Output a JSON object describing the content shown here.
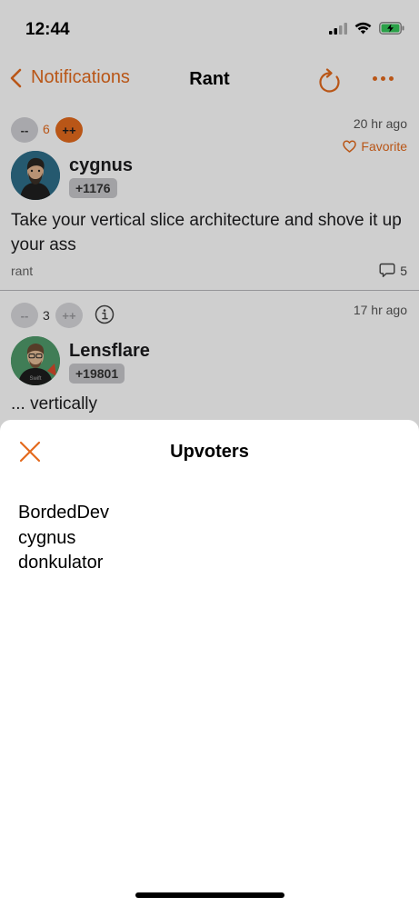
{
  "status_bar": {
    "time": "12:44"
  },
  "nav": {
    "back_label": "Notifications",
    "title": "Rant"
  },
  "rant": {
    "downvote_label": "--",
    "vote_count": "6",
    "upvote_label": "++",
    "time_ago": "20 hr ago",
    "favorite_label": "Favorite",
    "username": "cygnus",
    "score": "+1176",
    "text": "Take your vertical slice architecture and shove it up your ass",
    "tag": "rant",
    "comment_count": "5"
  },
  "comment": {
    "downvote_label": "--",
    "vote_count": "3",
    "upvote_label": "++",
    "time_ago": "17 hr ago",
    "username": "Lensflare",
    "score": "+19801",
    "avatar_shirt_text": "Swift",
    "text": "... vertically"
  },
  "sheet": {
    "title": "Upvoters",
    "upvoters": [
      "BordedDev",
      "cygnus",
      "donkulator"
    ]
  },
  "colors": {
    "accent": "#e46a1d",
    "battery": "#34c759"
  },
  "icons": {
    "back": "chevron-left-icon",
    "refresh": "refresh-icon",
    "more": "more-horizontal-icon",
    "favorite": "heart-icon",
    "comments": "speech-bubble-icon",
    "info": "info-circle-icon",
    "close": "close-icon"
  }
}
